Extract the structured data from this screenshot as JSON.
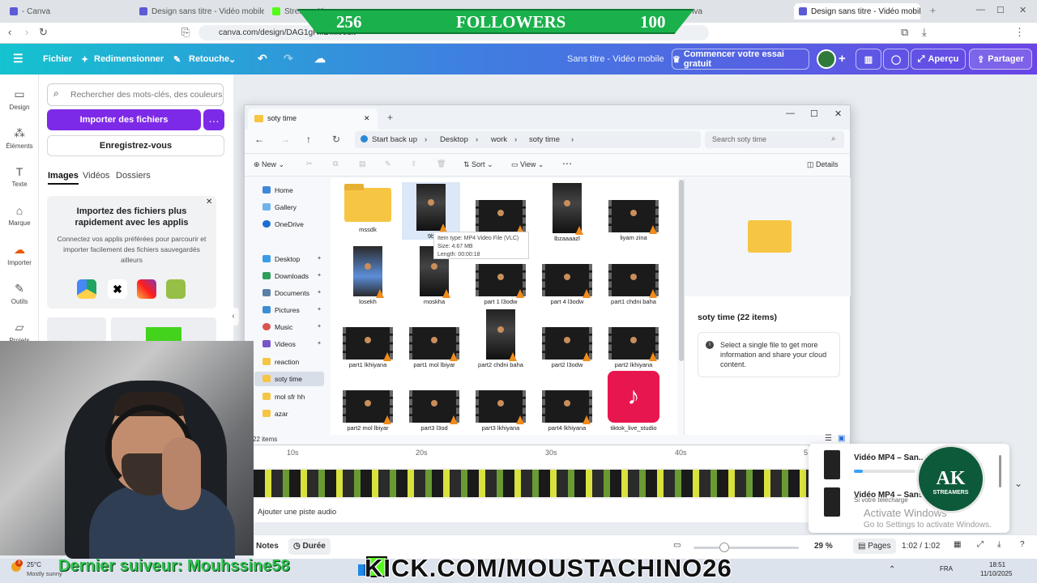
{
  "browser": {
    "tabs": [
      {
        "label": "- Canva"
      },
      {
        "label": "Design sans titre - Vidéo mobile"
      },
      {
        "label": "Stream - Kick"
      },
      {
        "label": "nva"
      },
      {
        "label": "Design sans titre - Vidéo mobile",
        "active": true
      }
    ],
    "url": "canva.com/design/DAG1gF...D...x/edit"
  },
  "canva_header": {
    "menu_file": "Fichier",
    "resize": "Redimensionner",
    "retouch": "Retouche",
    "doc_title": "Sans titre - Vidéo mobile",
    "trial": "Commencer votre essai gratuit",
    "preview": "Aperçu",
    "share": "Partager"
  },
  "rail": [
    {
      "label": "Design",
      "icon": "design-icon"
    },
    {
      "label": "Éléments",
      "icon": "elements-icon"
    },
    {
      "label": "Texte",
      "icon": "text-icon"
    },
    {
      "label": "Marque",
      "icon": "brand-icon"
    },
    {
      "label": "Importer",
      "icon": "upload-icon"
    },
    {
      "label": "Outils",
      "icon": "tools-icon"
    },
    {
      "label": "Projets",
      "icon": "folder-icon"
    }
  ],
  "panel": {
    "search_placeholder": "Rechercher des mots-clés, des couleurs",
    "import_btn": "Importer des fichiers",
    "save_btn": "Enregistrez-vous",
    "tabs": [
      "Images",
      "Vidéos",
      "Dossiers"
    ],
    "promo_title": "Importez des fichiers plus rapidement avec les applis",
    "promo_text": "Connectez vos applis préférées pour parcourir et importer facilement des fichiers sauvegardés ailleurs"
  },
  "explorer": {
    "tab_title": "soty time",
    "breadcrumbs": [
      "Start back up",
      "Desktop",
      "work",
      "soty time"
    ],
    "search_placeholder": "Search soty time",
    "cmd": {
      "new": "New",
      "sort": "Sort",
      "view": "View",
      "details": "Details"
    },
    "tree": [
      {
        "label": "Home"
      },
      {
        "label": "Gallery"
      },
      {
        "label": "OneDrive"
      },
      {
        "label": "Desktop"
      },
      {
        "label": "Downloads"
      },
      {
        "label": "Documents"
      },
      {
        "label": "Pictures"
      },
      {
        "label": "Music"
      },
      {
        "label": "Videos"
      },
      {
        "label": "reaction"
      },
      {
        "label": "soty time",
        "selected": true
      },
      {
        "label": "mol sfr hh"
      },
      {
        "label": "azar"
      }
    ],
    "files": [
      "mssdk",
      "9b",
      "",
      "lbzaaaazl",
      "liyam zina",
      "losekh",
      "moskha",
      "part 1 l3odw",
      "part 4 l3odw",
      "part1 chdni baha",
      "part1 lkhiyana",
      "part1 mol lbiyar",
      "part2 chdni baha",
      "part2 l3odw",
      "part2 lkhiyana",
      "part2 mol lbiyar",
      "part3 l3od",
      "part3 lkhiyana",
      "part4 lkhiyana",
      "tiktok_live_studio"
    ],
    "tooltip": [
      "Item type: MP4 Video File (VLC)",
      "Size: 4.67 MB",
      "Length: 00:00:18"
    ],
    "details_title": "soty time (22 items)",
    "details_text": "Select a single file to get more information and share your cloud content.",
    "status": "22 items"
  },
  "timeline": {
    "ticks": [
      "10s",
      "20s",
      "30s",
      "40s",
      "5"
    ],
    "add_audio": "Ajouter une piste audio"
  },
  "notifications": [
    {
      "title": "Vidéo MP4 – San...",
      "progress": 0.14
    },
    {
      "title": "Vidéo MP4 – Sans...",
      "sub": "Si votre télécharge"
    }
  ],
  "watermark": {
    "line1": "Activate Windows",
    "line2": "Go to Settings to activate Windows."
  },
  "logo": {
    "text": "AK",
    "sub": "STREAMERS"
  },
  "bottombar": {
    "notes": "Notes",
    "duration": "Durée",
    "zoom": "29 %",
    "pages": "Pages",
    "time": "1:02 / 1:02"
  },
  "taskbar": {
    "temp": "25°C",
    "weather": "Mostly sunny",
    "lang": "FRA",
    "clock": "18:51",
    "date": "11/10/2025"
  },
  "overlay": {
    "followers_count": "256",
    "followers_label": "FOLLOWERS",
    "followers_goal": "100",
    "last_follower": "Dernier suiveur: Mouhssine58",
    "kick_url": "KICK.COM/MOUSTACHINO26"
  },
  "colors": {
    "canva_purple": "#7d2ae8",
    "kick_green": "#53fc18"
  }
}
